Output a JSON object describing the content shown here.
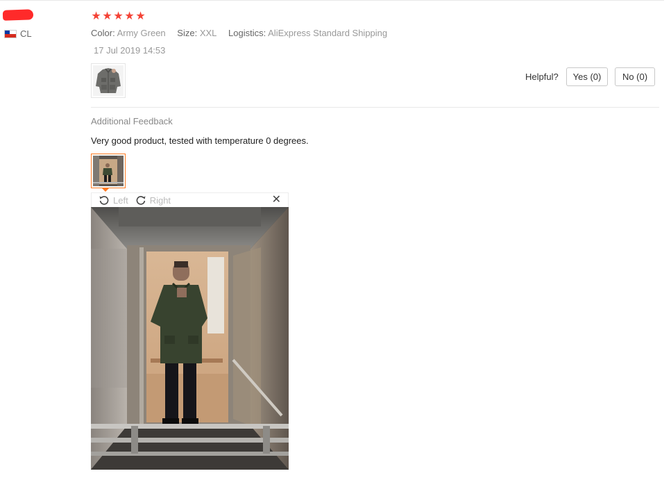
{
  "user": {
    "country_code": "CL",
    "flag_icon": "chile-flag-icon"
  },
  "review": {
    "rating": 5,
    "stars": [
      "★",
      "★",
      "★",
      "★",
      "★"
    ],
    "star_color": "#f44336",
    "color_label": "Color:",
    "color_value": "Army Green",
    "size_label": "Size:",
    "size_value": "XXL",
    "logistics_label": "Logistics:",
    "logistics_value": "AliExpress Standard Shipping",
    "date": "17 Jul 2019 14:53",
    "helpful_label": "Helpful?",
    "yes_label": "Yes (0)",
    "no_label": "No (0)"
  },
  "additional": {
    "title": "Additional Feedback",
    "text": "Very good product, tested with temperature 0 degrees."
  },
  "viewer": {
    "rotate_left_label": "Left",
    "rotate_right_label": "Right",
    "close_glyph": "✕",
    "accent_color": "#ff7a22"
  }
}
